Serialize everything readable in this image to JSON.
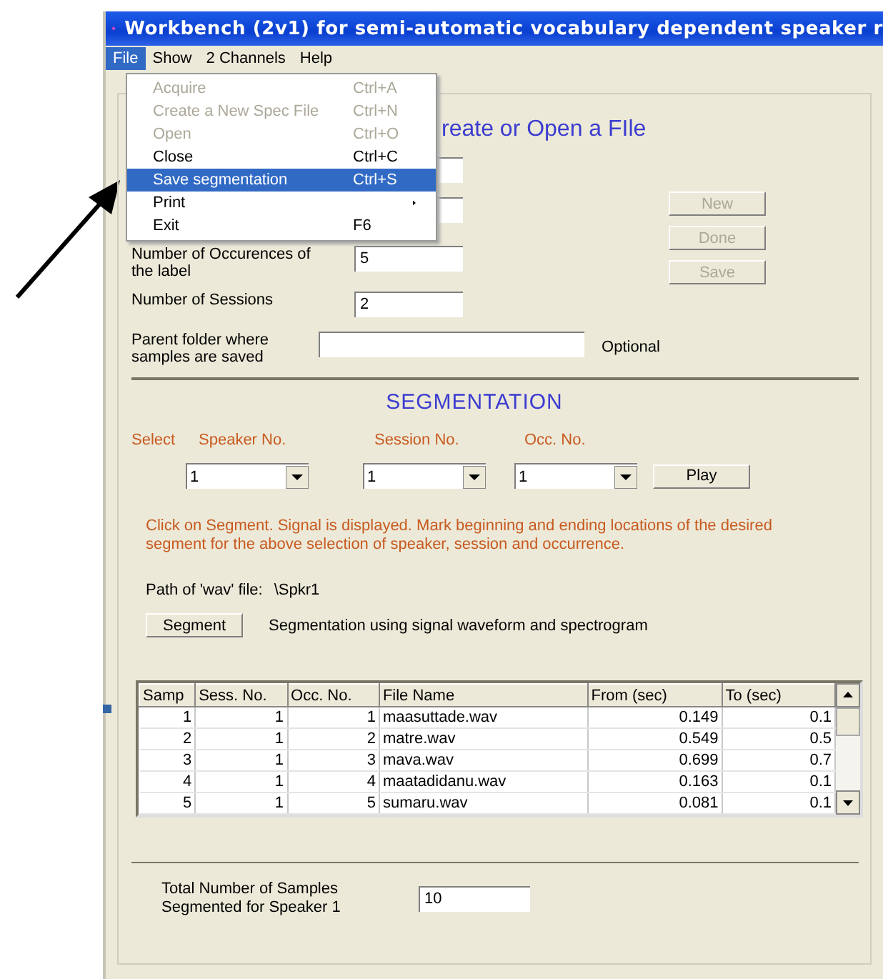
{
  "window": {
    "title": "Workbench (2v1) for semi-automatic vocabulary dependent speaker r"
  },
  "menu_bar": [
    {
      "label": "File",
      "selected": true
    },
    {
      "label": "Show",
      "selected": false
    },
    {
      "label": "2 Channels",
      "selected": false
    },
    {
      "label": "Help",
      "selected": false
    }
  ],
  "file_menu": [
    {
      "label": "Acquire",
      "shortcut": "Ctrl+A",
      "kind": "command",
      "disabled": true,
      "selected": false
    },
    {
      "label": "Create a New Spec File",
      "shortcut": "Ctrl+N",
      "kind": "command",
      "disabled": true,
      "selected": false
    },
    {
      "label": "Open",
      "shortcut": "Ctrl+O",
      "kind": "command",
      "disabled": true,
      "selected": false
    },
    {
      "label": "Close",
      "shortcut": "Ctrl+C",
      "kind": "command",
      "disabled": false,
      "selected": false
    },
    {
      "label": "Save segmentation",
      "shortcut": "Ctrl+S",
      "kind": "command",
      "disabled": false,
      "selected": true
    },
    {
      "label": "Print",
      "kind": "submenu",
      "disabled": false,
      "selected": false
    },
    {
      "label": "Exit",
      "shortcut": "F6",
      "kind": "command",
      "disabled": false,
      "selected": false
    }
  ],
  "form": {
    "heading": "reate or Open a FIle",
    "buttons": [
      {
        "label": "New",
        "disabled": true
      },
      {
        "label": "Done",
        "disabled": true
      },
      {
        "label": "Save",
        "disabled": true
      }
    ],
    "fields": [
      {
        "label": "Number of Occurences of the label",
        "value": "5"
      },
      {
        "label": "Number of Sessions",
        "value": "2"
      },
      {
        "label": "Parent folder where samples are saved",
        "note": "Optional"
      }
    ]
  },
  "segmentation": {
    "title": "SEGMENTATION",
    "select_label": "Select",
    "combos": [
      {
        "label": "Speaker No.",
        "value": "1"
      },
      {
        "label": "Session No.",
        "value": "1"
      },
      {
        "label": "Occ. No.",
        "value": "1"
      }
    ],
    "play_button": "Play",
    "instruction": "Click on Segment. Signal is displayed. Mark beginning and ending locations of the desired segment for the above selection of speaker, session and occurrence.",
    "path_label": "Path of 'wav' file:",
    "path_value": "\\Spkr1",
    "segment_button": "Segment",
    "segment_description": "Segmentation using signal waveform and spectrogram"
  },
  "table": {
    "columns": [
      "Samp",
      "Sess. No.",
      "Occ. No.",
      "File Name",
      "From (sec)",
      "To (sec)"
    ],
    "rows": [
      [
        "1",
        "1",
        "1",
        "maasuttade.wav",
        "0.149",
        "0.1"
      ],
      [
        "2",
        "1",
        "2",
        "matre.wav",
        "0.549",
        "0.5"
      ],
      [
        "3",
        "1",
        "3",
        "mava.wav",
        "0.699",
        "0.7"
      ],
      [
        "4",
        "1",
        "4",
        "maatadidanu.wav",
        "0.163",
        "0.1"
      ],
      [
        "5",
        "1",
        "5",
        "sumaru.wav",
        "0.081",
        "0.1"
      ]
    ]
  },
  "total": {
    "label": "Total Number of Samples Segmented for Speaker 1",
    "value": "10"
  }
}
